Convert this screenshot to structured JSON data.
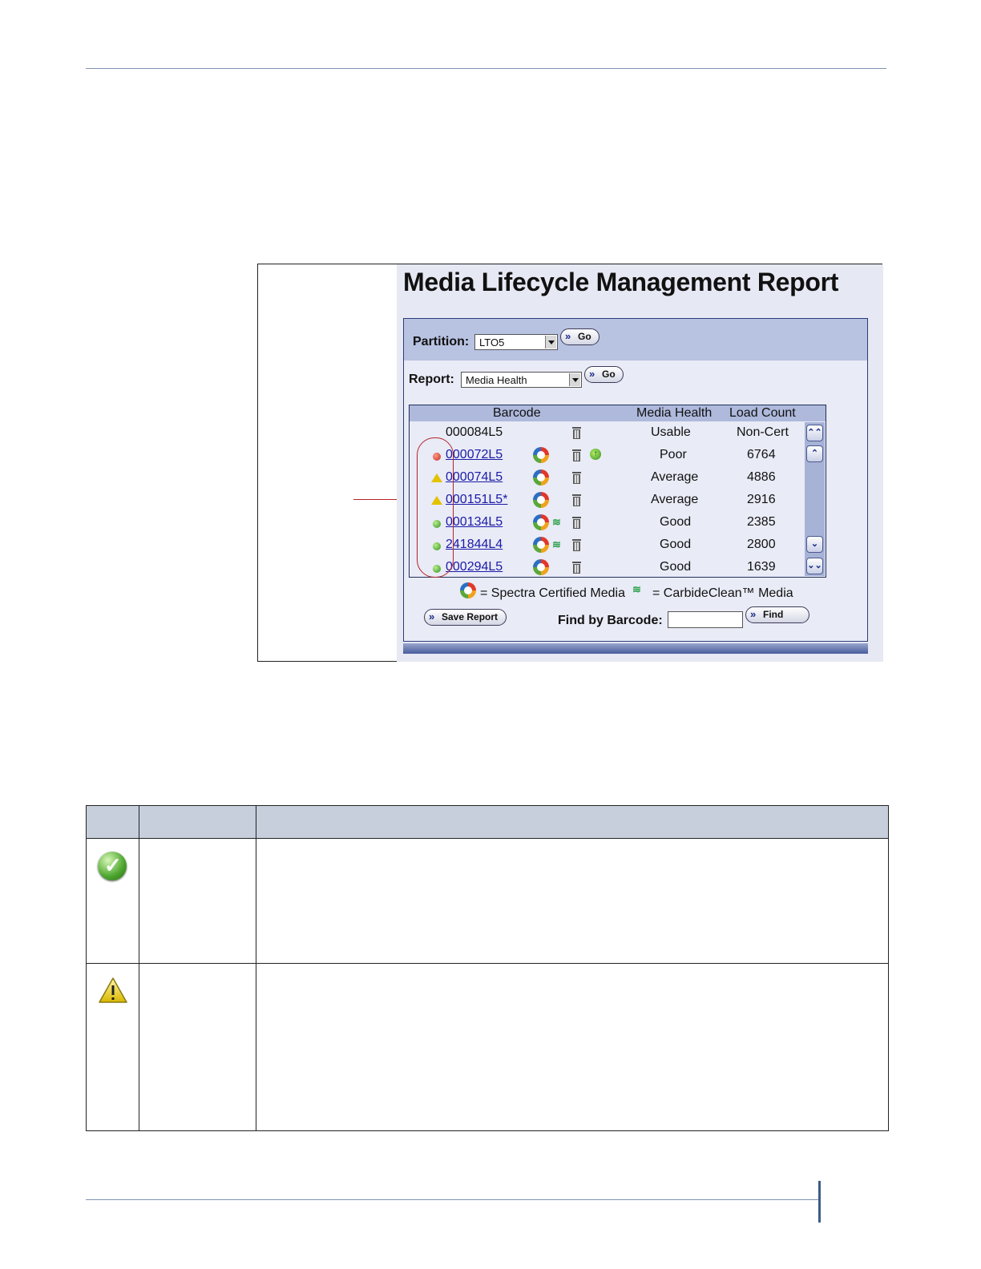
{
  "figure": {
    "title": "Media Lifecycle Management Report",
    "partition_label": "Partition:",
    "partition_value": "LTO5",
    "report_label": "Report:",
    "report_value": "Media Health",
    "go_label": "Go",
    "columns": {
      "barcode": "Barcode",
      "media_health": "Media Health",
      "load_count": "Load Count"
    },
    "rows": [
      {
        "status": "none",
        "barcode": "000084L5",
        "link": false,
        "certified": false,
        "carbide": false,
        "upgrade": false,
        "health": "Usable",
        "load": "Non-Cert"
      },
      {
        "status": "poor",
        "barcode": "000072L5",
        "link": true,
        "certified": true,
        "carbide": false,
        "upgrade": true,
        "health": "Poor",
        "load": "6764"
      },
      {
        "status": "average",
        "barcode": "000074L5",
        "link": true,
        "certified": true,
        "carbide": false,
        "upgrade": false,
        "health": "Average",
        "load": "4886"
      },
      {
        "status": "average",
        "barcode": "000151L5*",
        "link": true,
        "certified": true,
        "carbide": false,
        "upgrade": false,
        "health": "Average",
        "load": "2916"
      },
      {
        "status": "good",
        "barcode": "000134L5",
        "link": true,
        "certified": true,
        "carbide": true,
        "upgrade": false,
        "health": "Good",
        "load": "2385"
      },
      {
        "status": "good",
        "barcode": "241844L4",
        "link": true,
        "certified": true,
        "carbide": true,
        "upgrade": false,
        "health": "Good",
        "load": "2800"
      },
      {
        "status": "good",
        "barcode": "000294L5",
        "link": true,
        "certified": true,
        "carbide": false,
        "upgrade": false,
        "health": "Good",
        "load": "1639"
      }
    ],
    "legend_certified": "= Spectra Certified Media",
    "legend_carbide": "= CarbideClean™ Media",
    "save_report_label": "Save Report",
    "find_by_barcode_label": "Find by Barcode:",
    "find_label": "Find"
  },
  "status_table": {
    "icons": [
      "check-icon",
      "warning-icon"
    ]
  },
  "colors": {
    "panel": "#e6e8f3",
    "header": "#b8c2e1",
    "link": "#1a1aa8",
    "callout": "#b3242b"
  }
}
